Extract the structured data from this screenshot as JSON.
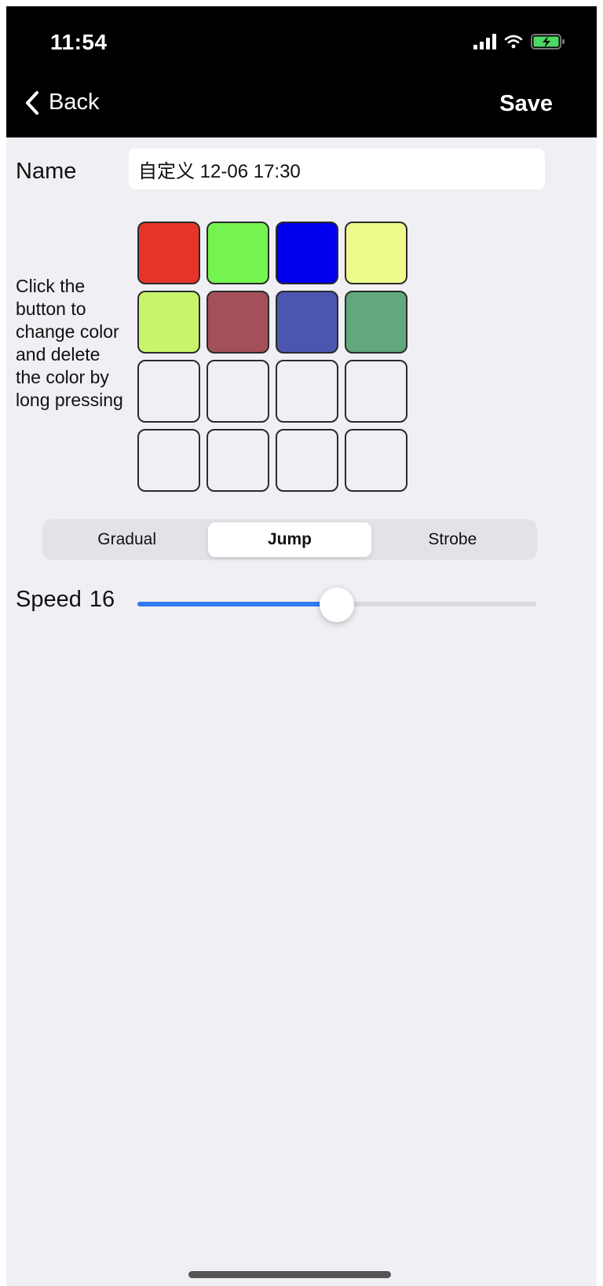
{
  "status_bar": {
    "time": "11:54",
    "battery_color": "#4cd964"
  },
  "nav": {
    "back_label": "Back",
    "save_label": "Save"
  },
  "name": {
    "label": "Name",
    "value": "自定义 12-06 17:30"
  },
  "instruction": "Click the button to change color and delete the color by long pressing",
  "colors": [
    "#e6342a",
    "#75f34f",
    "#0000ee",
    "#eefb8c",
    "#c7f66d",
    "#a3505a",
    "#4a56b0",
    "#62a87e",
    "",
    "",
    "",
    "",
    "",
    "",
    "",
    ""
  ],
  "modes": {
    "options": [
      "Gradual",
      "Jump",
      "Strobe"
    ],
    "selected": "Jump"
  },
  "speed": {
    "label": "Speed",
    "value": "16",
    "level_fraction": 0.5
  },
  "accent_color": "#2f7bf0"
}
